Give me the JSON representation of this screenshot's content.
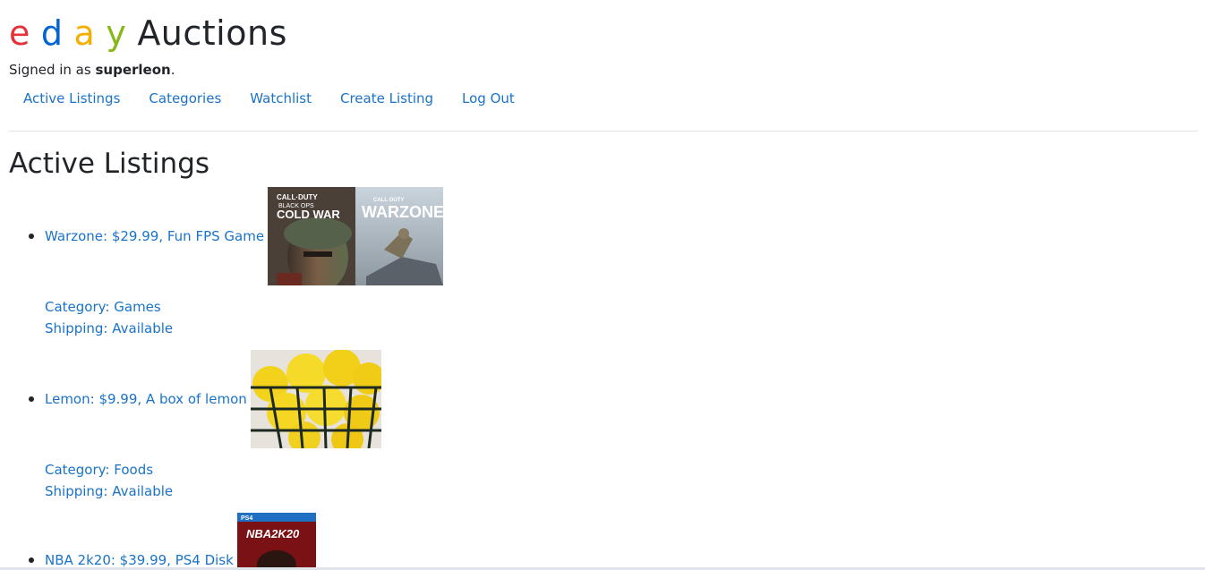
{
  "brand": {
    "letters": [
      "e",
      "d",
      "a",
      "y"
    ],
    "word": "Auctions",
    "colors": {
      "e": "#e53238",
      "d": "#0064d2",
      "a": "#f5af02",
      "y": "#86b817"
    }
  },
  "user": {
    "signed_in_prefix": "Signed in as",
    "username": "superleon",
    "suffix": "."
  },
  "nav": {
    "items": [
      {
        "label": "Active Listings"
      },
      {
        "label": "Categories"
      },
      {
        "label": "Watchlist"
      },
      {
        "label": "Create Listing"
      },
      {
        "label": "Log Out"
      }
    ]
  },
  "main": {
    "title": "Active Listings",
    "listings": [
      {
        "summary": "Warzone: $29.99, Fun FPS Game",
        "image_text_1": "CALL·DUTY BLACK OPS COLD WAR",
        "image_text_2": "CALL·DUTY WARZONE",
        "category": "Category: Games",
        "shipping": "Shipping: Available"
      },
      {
        "summary": "Lemon: $9.99, A box of lemon",
        "category": "Category: Foods",
        "shipping": "Shipping: Available"
      },
      {
        "summary": "NBA 2k20: $39.99, PS4 Disk",
        "image_text_1": "PS4",
        "image_text_2": "NBA2K20"
      }
    ]
  },
  "colors": {
    "link": "#1a73c9",
    "text": "#212529",
    "divider": "#e1e3e5"
  }
}
